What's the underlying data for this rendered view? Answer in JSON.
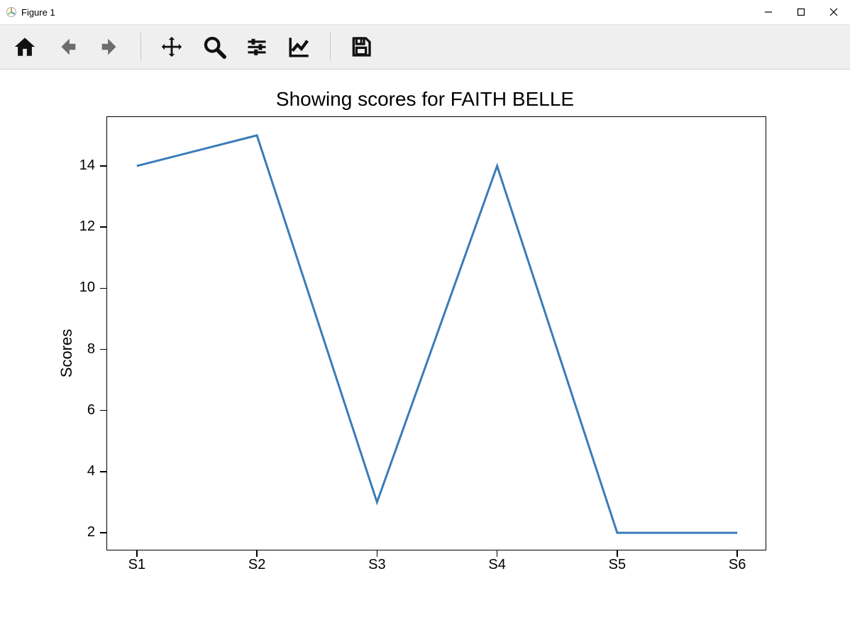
{
  "window": {
    "title": "Figure 1"
  },
  "toolbar": {
    "home": "home-icon",
    "back": "arrow-left-icon",
    "forward": "arrow-right-icon",
    "pan": "move-icon",
    "zoom": "search-icon",
    "configure": "sliders-icon",
    "axes": "chart-line-icon",
    "save": "save-icon"
  },
  "chart_data": {
    "type": "line",
    "categories": [
      "S1",
      "S2",
      "S3",
      "S4",
      "S5",
      "S6"
    ],
    "values": [
      14,
      15,
      3,
      14,
      2,
      2
    ],
    "title": "Showing scores for FAITH BELLE",
    "xlabel": "",
    "ylabel": "Scores",
    "ylim": [
      1.4,
      15.6
    ],
    "yticks": [
      2,
      4,
      6,
      8,
      10,
      12,
      14
    ],
    "line_color": "#3a7cb8"
  }
}
